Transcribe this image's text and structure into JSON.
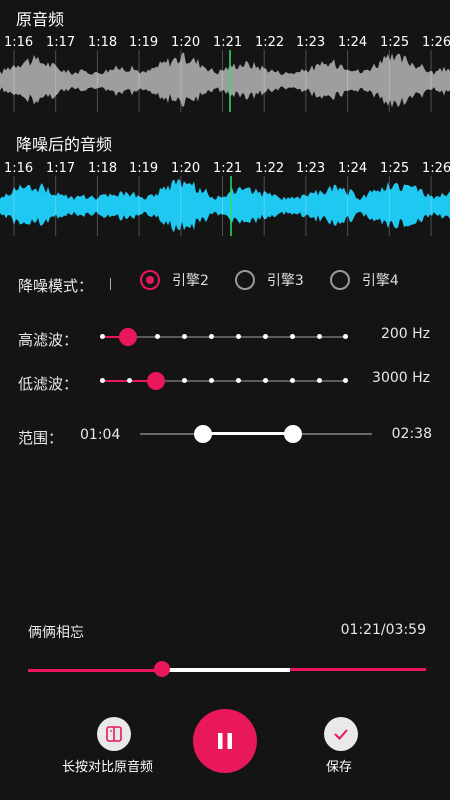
{
  "original": {
    "title": "原音频",
    "ticks": [
      "1:16",
      "1:17",
      "1:18",
      "1:19",
      "1:20",
      "1:21",
      "1:22",
      "1:23",
      "1:24",
      "1:25",
      "1:26"
    ]
  },
  "denoised": {
    "title": "降噪后的音频",
    "ticks": [
      "1:16",
      "1:17",
      "1:18",
      "1:19",
      "1:20",
      "1:21",
      "1:22",
      "1:23",
      "1:24",
      "1:25",
      "1:26"
    ]
  },
  "mode": {
    "label": "降噪模式：",
    "options": [
      "引擎2",
      "引擎3",
      "引擎4"
    ],
    "selected": "引擎2"
  },
  "highpass": {
    "label": "高滤波：",
    "value": "200 Hz"
  },
  "lowpass": {
    "label": "低滤波：",
    "value": "3000 Hz"
  },
  "range": {
    "label": "范围：",
    "start": "01:04",
    "end": "02:38"
  },
  "player": {
    "song": "俩俩相忘",
    "time": "01:21/03:59",
    "compare_label": "长按对比原音频",
    "save_label": "保存"
  },
  "colors": {
    "accent": "#e8185a",
    "wave_original": "#9e9e9e",
    "wave_denoised": "#1ec8f0",
    "playhead": "#2ee06a"
  }
}
